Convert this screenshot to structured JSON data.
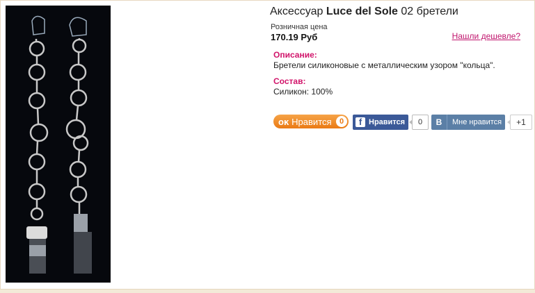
{
  "product": {
    "title_prefix": "Аксессуар ",
    "title_brand": "Luce del Sole",
    "title_suffix": " 02 бретели",
    "price_label": "Розничная цена",
    "price_value": "170.19 Руб",
    "cheaper_link": "Нашли дешевле?",
    "image_alt": "Бретели силиконовые с металлическим узором кольца",
    "description_label": "Описание:",
    "description_text": "Бретели силиконовые с металлическим узором \"кольца\".",
    "composition_label": "Состав:",
    "composition_text": "Силикон: 100%"
  },
  "social": {
    "ok": {
      "icon": "odnoklassniki-icon",
      "label": "Нравится",
      "count": "0",
      "color": "#ee8208"
    },
    "fb": {
      "icon": "facebook-icon",
      "label": "Нравится",
      "count": "0",
      "color": "#3b5998"
    },
    "vk": {
      "icon": "vkontakte-icon",
      "icon_text": "В",
      "label": "Мне нравится",
      "color": "#5b7fa6"
    },
    "gplus": {
      "label": "+1"
    }
  },
  "colors": {
    "accent": "#d1146a",
    "border": "#e8d8c0"
  }
}
